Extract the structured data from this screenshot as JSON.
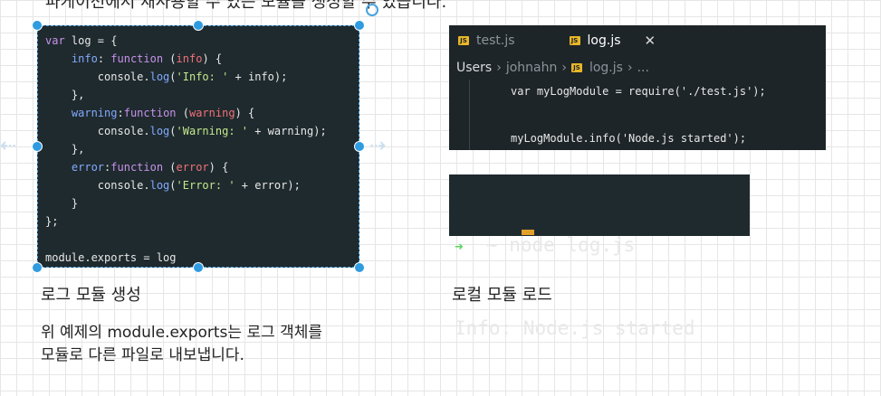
{
  "top_caption": "파케이션에서 재사용할 수 있는 모듈을 생성할 수 있습니다.",
  "code_box": {
    "lines": [
      [
        [
          "kw",
          "var "
        ],
        [
          "txt",
          "log = {"
        ]
      ],
      [
        [
          "txt",
          "    "
        ],
        [
          "prop",
          "info"
        ],
        [
          "txt",
          ": "
        ],
        [
          "kw",
          "function "
        ],
        [
          "txt",
          "("
        ],
        [
          "param",
          "info"
        ],
        [
          "txt",
          ") {"
        ]
      ],
      [
        [
          "txt",
          "        console."
        ],
        [
          "fn",
          "log"
        ],
        [
          "txt",
          "("
        ],
        [
          "str",
          "'Info: '"
        ],
        [
          "txt",
          " + info);"
        ]
      ],
      [
        [
          "txt",
          "    },"
        ]
      ],
      [
        [
          "txt",
          "    "
        ],
        [
          "prop",
          "warning"
        ],
        [
          "txt",
          ":"
        ],
        [
          "kw",
          "function "
        ],
        [
          "txt",
          "("
        ],
        [
          "param",
          "warning"
        ],
        [
          "txt",
          ") {"
        ]
      ],
      [
        [
          "txt",
          "        console."
        ],
        [
          "fn",
          "log"
        ],
        [
          "txt",
          "("
        ],
        [
          "str",
          "'Warning: '"
        ],
        [
          "txt",
          " + warning);"
        ]
      ],
      [
        [
          "txt",
          "    },"
        ]
      ],
      [
        [
          "txt",
          "    "
        ],
        [
          "prop",
          "error"
        ],
        [
          "txt",
          ":"
        ],
        [
          "kw",
          "function "
        ],
        [
          "txt",
          "("
        ],
        [
          "param",
          "error"
        ],
        [
          "txt",
          ") {"
        ]
      ],
      [
        [
          "txt",
          "        console."
        ],
        [
          "fn",
          "log"
        ],
        [
          "txt",
          "("
        ],
        [
          "str",
          "'Error: '"
        ],
        [
          "txt",
          " + error);"
        ]
      ],
      [
        [
          "txt",
          "    }"
        ]
      ],
      [
        [
          "txt",
          "};"
        ]
      ]
    ],
    "export_line": "module.exports = log"
  },
  "editor": {
    "tabs": [
      {
        "label": "test.js",
        "icon": "JS"
      },
      {
        "label": "log.js",
        "icon": "JS"
      }
    ],
    "close_symbol": "✕",
    "breadcrumb": {
      "users": "Users",
      "user": "johnahn",
      "file": "log.js",
      "more": "..."
    },
    "code_line_1": "var myLogModule = require('./test.js');",
    "code_line_2": "myLogModule.info('Node.js started');"
  },
  "terminal": {
    "prompt_symbol": "➜",
    "command": "  ~ node log.js",
    "output": "Info: Node.js started"
  },
  "label_left": "로그 모듈 생성",
  "label_right": "로컬 모듈 로드",
  "description_line1": "위 예제의 module.exports는 로그 객체를",
  "description_line2": "모듈로 다른 파일로 내보냅니다."
}
